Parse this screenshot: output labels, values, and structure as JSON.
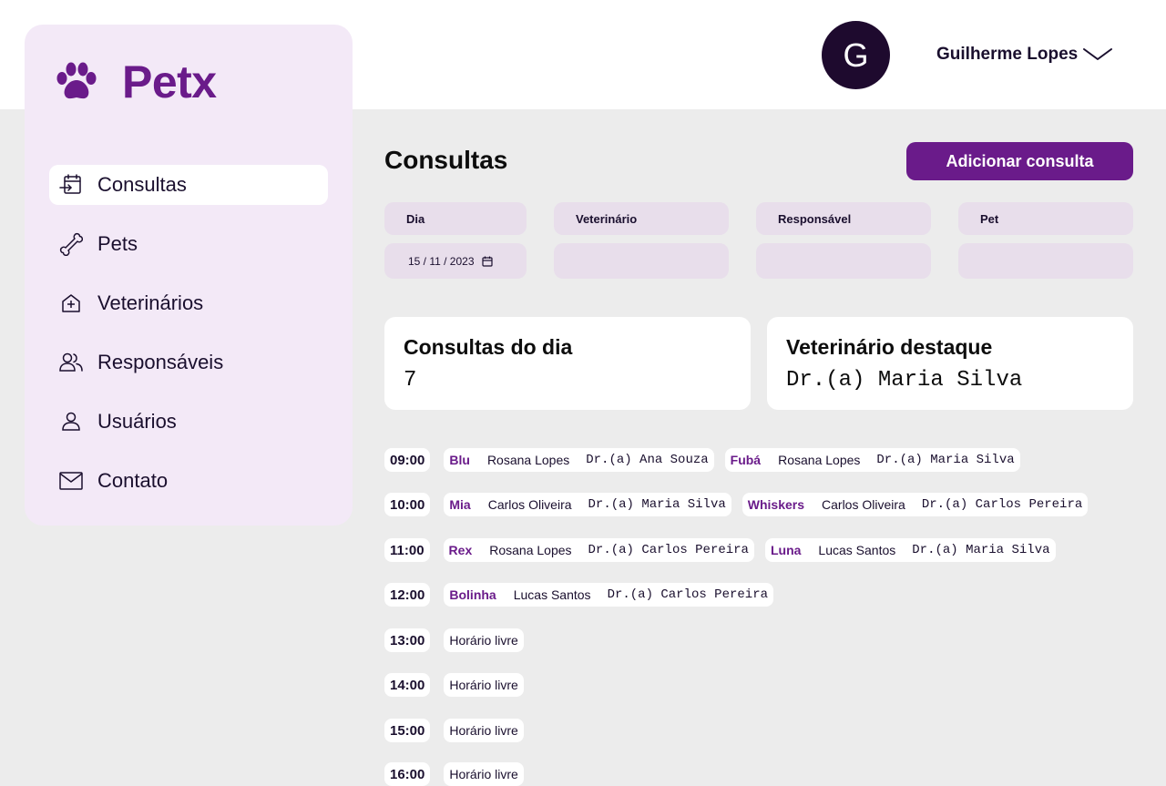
{
  "app": {
    "name": "Petx"
  },
  "user": {
    "initial": "G",
    "name": "Guilherme Lopes"
  },
  "sidebar": {
    "items": [
      {
        "label": "Consultas",
        "icon": "calendar-icon",
        "active": true
      },
      {
        "label": "Pets",
        "icon": "bone-icon",
        "active": false
      },
      {
        "label": "Veterinários",
        "icon": "medical-house-icon",
        "active": false
      },
      {
        "label": "Responsáveis",
        "icon": "people-icon",
        "active": false
      },
      {
        "label": "Usuários",
        "icon": "user-icon",
        "active": false
      },
      {
        "label": "Contato",
        "icon": "mail-icon",
        "active": false
      }
    ]
  },
  "main": {
    "title": "Consultas",
    "add_button": "Adicionar consulta",
    "filters": {
      "dia": {
        "label": "Dia",
        "value": "15 / 11 / 2023"
      },
      "veterinario": {
        "label": "Veterinário",
        "value": ""
      },
      "responsavel": {
        "label": "Responsável",
        "value": ""
      },
      "pet": {
        "label": "Pet",
        "value": ""
      }
    },
    "cards": {
      "consultas_dia": {
        "title": "Consultas do dia",
        "value": "7"
      },
      "vet_destaque": {
        "title": "Veterinário destaque",
        "value": "Dr.(a) Maria Silva"
      }
    },
    "free_label": "Horário livre",
    "schedule": [
      {
        "time": "09:00",
        "appointments": [
          {
            "pet": "Blu",
            "owner": "Rosana Lopes",
            "vet": "Dr.(a) Ana Souza"
          },
          {
            "pet": "Fubá",
            "owner": "Rosana Lopes",
            "vet": "Dr.(a) Maria Silva"
          }
        ]
      },
      {
        "time": "10:00",
        "appointments": [
          {
            "pet": "Mia",
            "owner": "Carlos Oliveira",
            "vet": "Dr.(a) Maria Silva"
          },
          {
            "pet": "Whiskers",
            "owner": "Carlos Oliveira",
            "vet": "Dr.(a) Carlos Pereira"
          }
        ]
      },
      {
        "time": "11:00",
        "appointments": [
          {
            "pet": "Rex",
            "owner": "Rosana Lopes",
            "vet": "Dr.(a) Carlos Pereira"
          },
          {
            "pet": "Luna",
            "owner": "Lucas Santos",
            "vet": "Dr.(a) Maria Silva"
          }
        ]
      },
      {
        "time": "12:00",
        "appointments": [
          {
            "pet": "Bolinha",
            "owner": "Lucas Santos",
            "vet": "Dr.(a) Carlos Pereira"
          }
        ]
      },
      {
        "time": "13:00",
        "appointments": []
      },
      {
        "time": "14:00",
        "appointments": []
      },
      {
        "time": "15:00",
        "appointments": []
      },
      {
        "time": "16:00",
        "appointments": []
      }
    ]
  }
}
